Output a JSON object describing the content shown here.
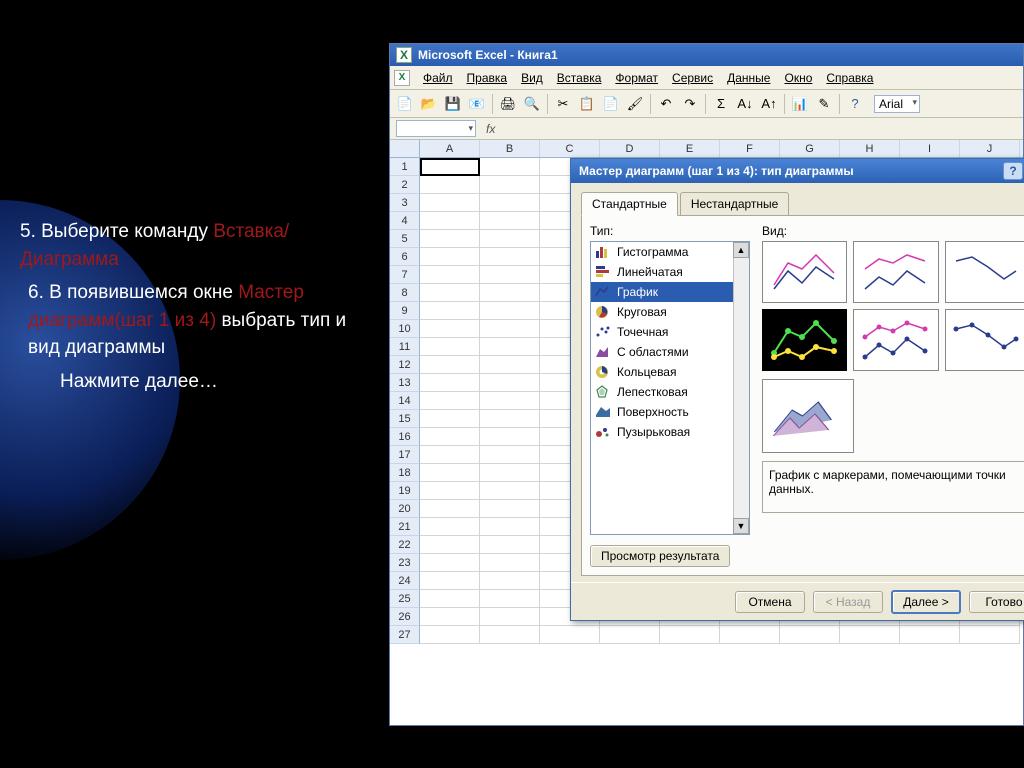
{
  "slide": {
    "p5_a": "5. Выберите команду ",
    "p5_b": "Вставка/Диаграмма",
    "p6_a": "6. В появившемся окне ",
    "p6_b": "Мастер диаграмм(шаг 1 из 4) ",
    "p6_c": "выбрать тип и вид диаграммы",
    "p7": "Нажмите далее…"
  },
  "excel": {
    "title": "Microsoft Excel - Книга1",
    "menu": [
      "Файл",
      "Правка",
      "Вид",
      "Вставка",
      "Формат",
      "Сервис",
      "Данные",
      "Окно",
      "Справка"
    ],
    "font": "Arial",
    "columns": [
      "A",
      "B",
      "C",
      "D",
      "E",
      "F",
      "G",
      "H",
      "I",
      "J"
    ],
    "rows": 27,
    "namebox": ""
  },
  "wizard": {
    "title": "Мастер диаграмм (шаг 1 из 4): тип диаграммы",
    "tabs": {
      "standard": "Стандартные",
      "custom": "Нестандартные"
    },
    "type_label": "Тип:",
    "view_label": "Вид:",
    "types": [
      "Гистограмма",
      "Линейчатая",
      "График",
      "Круговая",
      "Точечная",
      "С областями",
      "Кольцевая",
      "Лепестковая",
      "Поверхность",
      "Пузырьковая"
    ],
    "selected_type_index": 2,
    "description": "График с маркерами, помечающими точки данных.",
    "preview_btn": "Просмотр результата",
    "buttons": {
      "cancel": "Отмена",
      "back": "< Назад",
      "next": "Далее >",
      "finish": "Готово"
    }
  }
}
